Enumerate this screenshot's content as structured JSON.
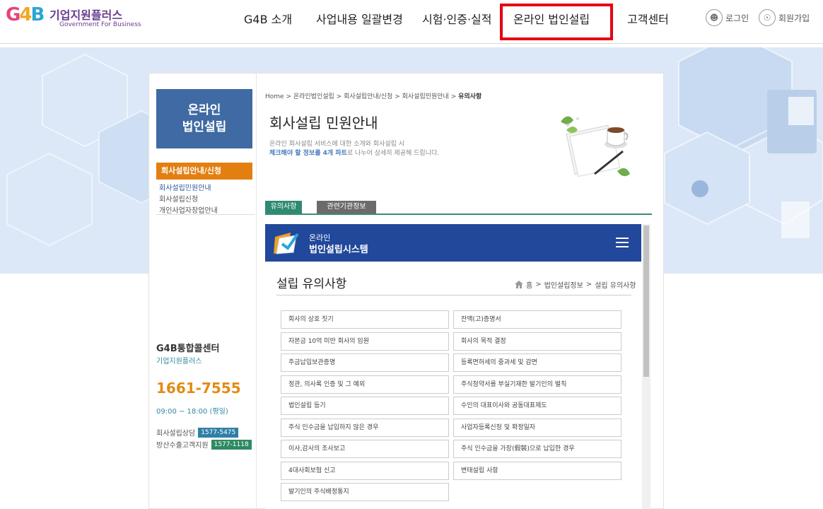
{
  "header": {
    "logo": {
      "mark": "G4B",
      "title": "기업지원플러스",
      "subtitle": "Government For Business"
    },
    "nav": [
      "G4B 소개",
      "사업내용 일괄변경",
      "시험·인증·실적",
      "온라인 법인설립",
      "고객센터"
    ],
    "login_label": "로그인",
    "join_label": "회원가입"
  },
  "lnb": {
    "title_line1": "온라인",
    "title_line2": "법인설립",
    "active_section": "회사설립안내/신청",
    "items": [
      "회사설립민원안내",
      "회사설립신청",
      "개인사업자창업안내"
    ]
  },
  "callcenter": {
    "title": "G4B통합콜센터",
    "subtitle": "기업지원플러스",
    "phone": "1661-7555",
    "hours": "09:00 ~ 18:00 (평일)",
    "row1_label": "회사설립상담",
    "row1_number": "1577-5475",
    "row2_label": "방산수출고객지원",
    "row2_number": "1577-1118"
  },
  "content": {
    "breadcrumb": "Home > 온라인법인설립 > 회사설립안내/신청 > 회사설립민원안내 > ",
    "breadcrumb_current": "유의사항",
    "title": "회사설립 민원안내",
    "desc_line1": "온라인 회사설립 서비스에 대한 소개와 회사설립 시",
    "desc_line2_em": "체크해야 할 정보를 4개 파트",
    "desc_line2_rest": "로 나누어 상세히 제공해 드립니다.",
    "tabs": [
      "유의사항",
      "관련기관정보"
    ]
  },
  "system": {
    "title_line1": "온라인",
    "title_line2": "법인설립시스템",
    "section_title": "설립 유의사항",
    "bc_home": "홈",
    "bc_mid": "법인설립정보",
    "bc_current": "설립 유의사항",
    "items_left": [
      "회사의 상호 짓기",
      "자본금 10억 미만 회사의 임원",
      "주금납입보관증명",
      "정관, 의사록 인증 및 그 예외",
      "법인설립 등기",
      "주식 인수금을 납입하지 않은 경우",
      "이사,감사의 조사보고",
      "4대사회보험 신고",
      "발기인의 주식배정통지"
    ],
    "items_right": [
      "잔액(고)증명서",
      "회사의 목적 결정",
      "등록면허세의 중과세 및 감면",
      "주식청약서를 부실기재한 발기인의 벌칙",
      "수인의 대표이사와 공동대표제도",
      "사업자등록신청 및 확정일자",
      "주식 인수금을 가장(假裝)으로 납입한 경우",
      "변태설립 사항"
    ]
  },
  "colors": {
    "lnb_blue": "#3f6aa3",
    "active_orange": "#e37f11",
    "phone_orange": "#e58a14",
    "system_header": "#21489a",
    "highlight_red": "#e60012",
    "tab_active": "#2f8a72",
    "tab_inactive": "#6b6b6b",
    "badge_blue": "#2f7fa6",
    "badge_green": "#2e8a63"
  },
  "icons": [
    "user-icon",
    "join-icon",
    "home-icon",
    "menu-icon",
    "coffee-deco-icon",
    "system-logo-icon"
  ]
}
